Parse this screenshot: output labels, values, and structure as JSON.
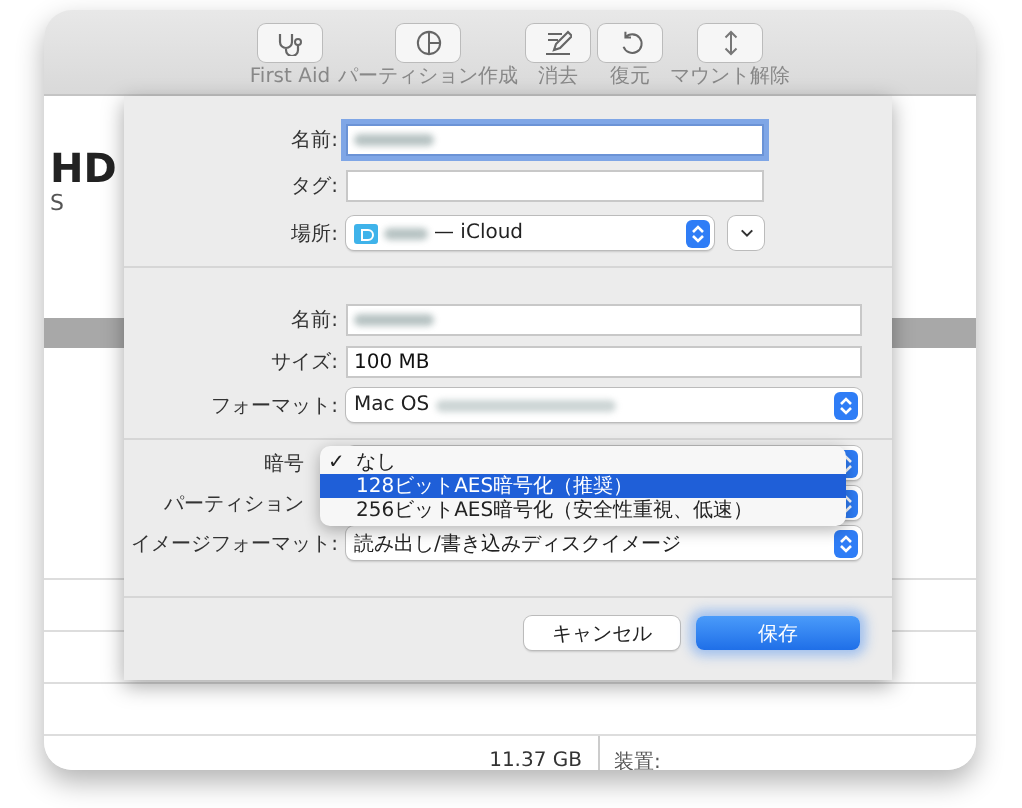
{
  "toolbar": [
    {
      "label": "First Aid",
      "kind": "first_aid"
    },
    {
      "label": "パーティション作成",
      "kind": "partition"
    },
    {
      "label": "消去",
      "kind": "erase"
    },
    {
      "label": "復元",
      "kind": "restore"
    },
    {
      "label": "マウント解除",
      "kind": "unmount"
    }
  ],
  "background": {
    "title": "HD",
    "subtitle": "S",
    "size": "11.37 GB",
    "device_label": "装置:"
  },
  "dialog": {
    "name": {
      "label": "名前:",
      "focused": true
    },
    "tags": {
      "label": "タグ:"
    },
    "location": {
      "label": "場所:",
      "value": "— iCloud"
    },
    "image": {
      "name_label": "名前:",
      "size_label": "サイズ:",
      "size": "100 MB",
      "format_label": "フォーマット:",
      "format": "Mac OS",
      "encryption_label": "暗号",
      "partition_label": "パーティション",
      "image_format_label": "イメージフォーマット:",
      "image_format": "読み出し/書き込みディスクイメージ"
    },
    "menu_check_mark": "✓",
    "menu": [
      {
        "label": "なし",
        "checked": true,
        "selected": false
      },
      {
        "label": "128ビットAES暗号化（推奨）",
        "checked": false,
        "selected": true
      },
      {
        "label": "256ビットAES暗号化（安全性重視、低速）",
        "checked": false,
        "selected": false
      }
    ],
    "buttons": [
      {
        "label": "キャンセル",
        "kind": "secondary"
      },
      {
        "label": "保存",
        "kind": "default"
      }
    ]
  }
}
